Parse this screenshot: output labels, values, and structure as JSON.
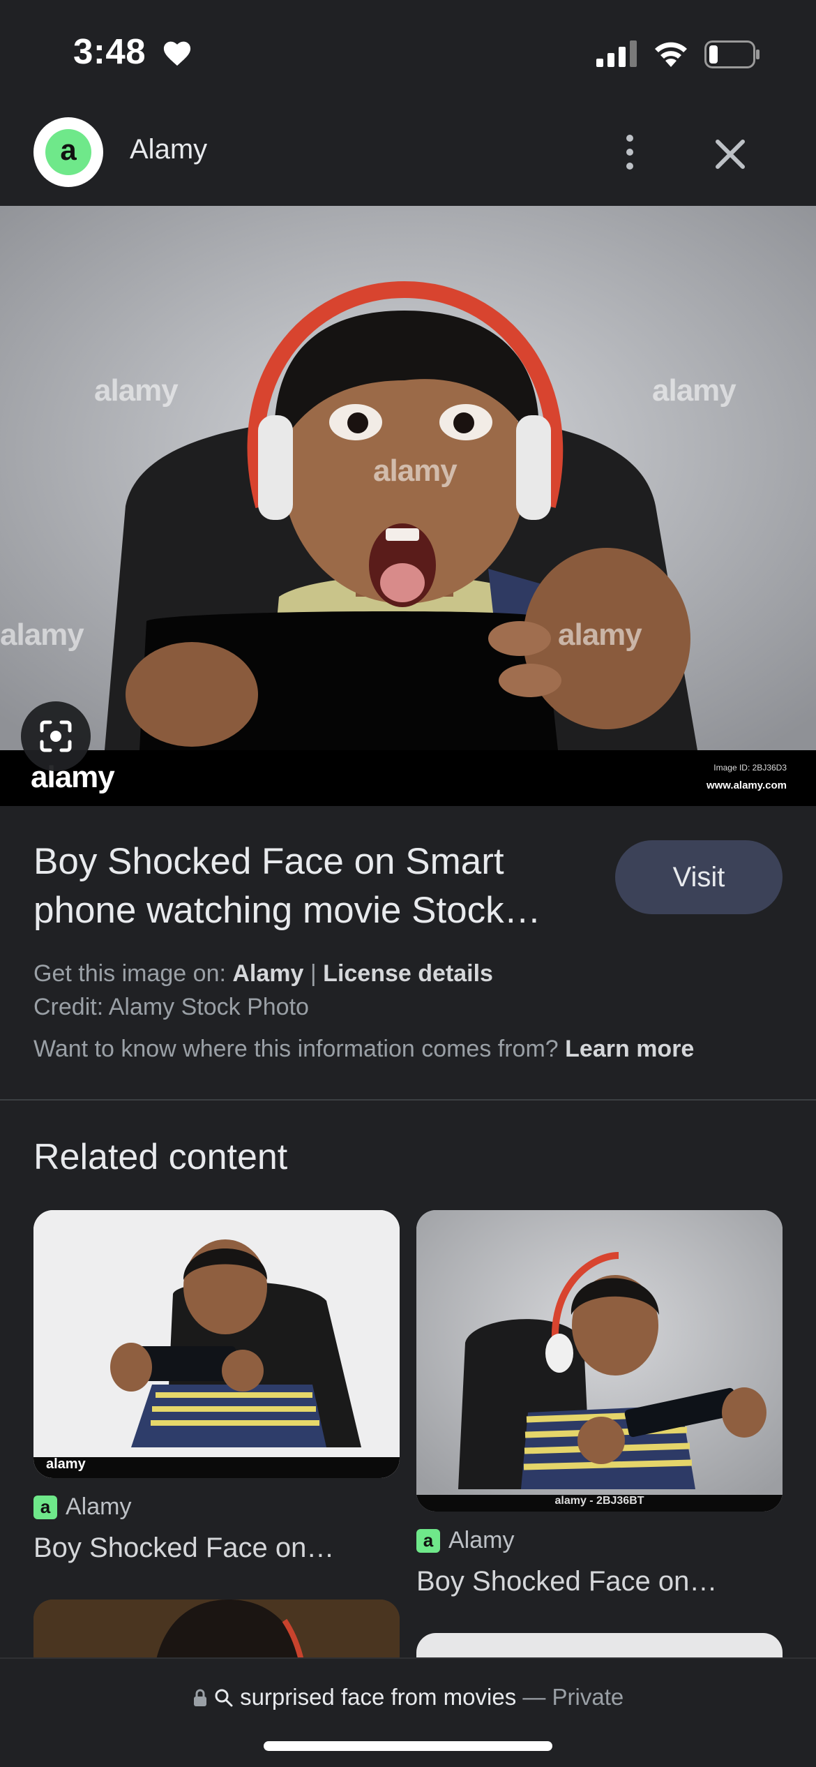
{
  "status_bar": {
    "time": "3:48",
    "battery_level": 0.2,
    "icons": [
      "heart-icon",
      "cellular-signal-icon",
      "wifi-icon",
      "battery-icon"
    ]
  },
  "header": {
    "site_name": "Alamy",
    "logo_letter": "a",
    "icons": [
      "more-vert-icon",
      "close-icon"
    ]
  },
  "hero": {
    "watermark": "alamy",
    "footer_brand": "alamy",
    "image_id": "Image ID: 2BJ36D3",
    "url": "www.alamy.com"
  },
  "result": {
    "title": "Boy Shocked Face on Smart phone watching movie Stock…",
    "visit_label": "Visit",
    "get_image_prefix": "Get this image on: ",
    "get_image_source": "Alamy",
    "separator": " | ",
    "license_details": "License details",
    "credit": "Credit: Alamy Stock Photo",
    "info_question": "Want to know where this information comes from? ",
    "learn_more": "Learn more"
  },
  "related": {
    "heading": "Related content",
    "cards": [
      {
        "source": "Alamy",
        "title": "Boy Shocked Face on…",
        "footer_brand": "alamy"
      },
      {
        "source": "Alamy",
        "title": "Boy Shocked Face on…",
        "footer_text": "alamy - 2BJ36BT"
      }
    ]
  },
  "bottom_bar": {
    "query": "surprised face from movies",
    "separator": " — ",
    "mode": "Private"
  },
  "colors": {
    "background": "#202124",
    "visit_button": "#3c4258",
    "favicon_green": "#6fe88a"
  }
}
